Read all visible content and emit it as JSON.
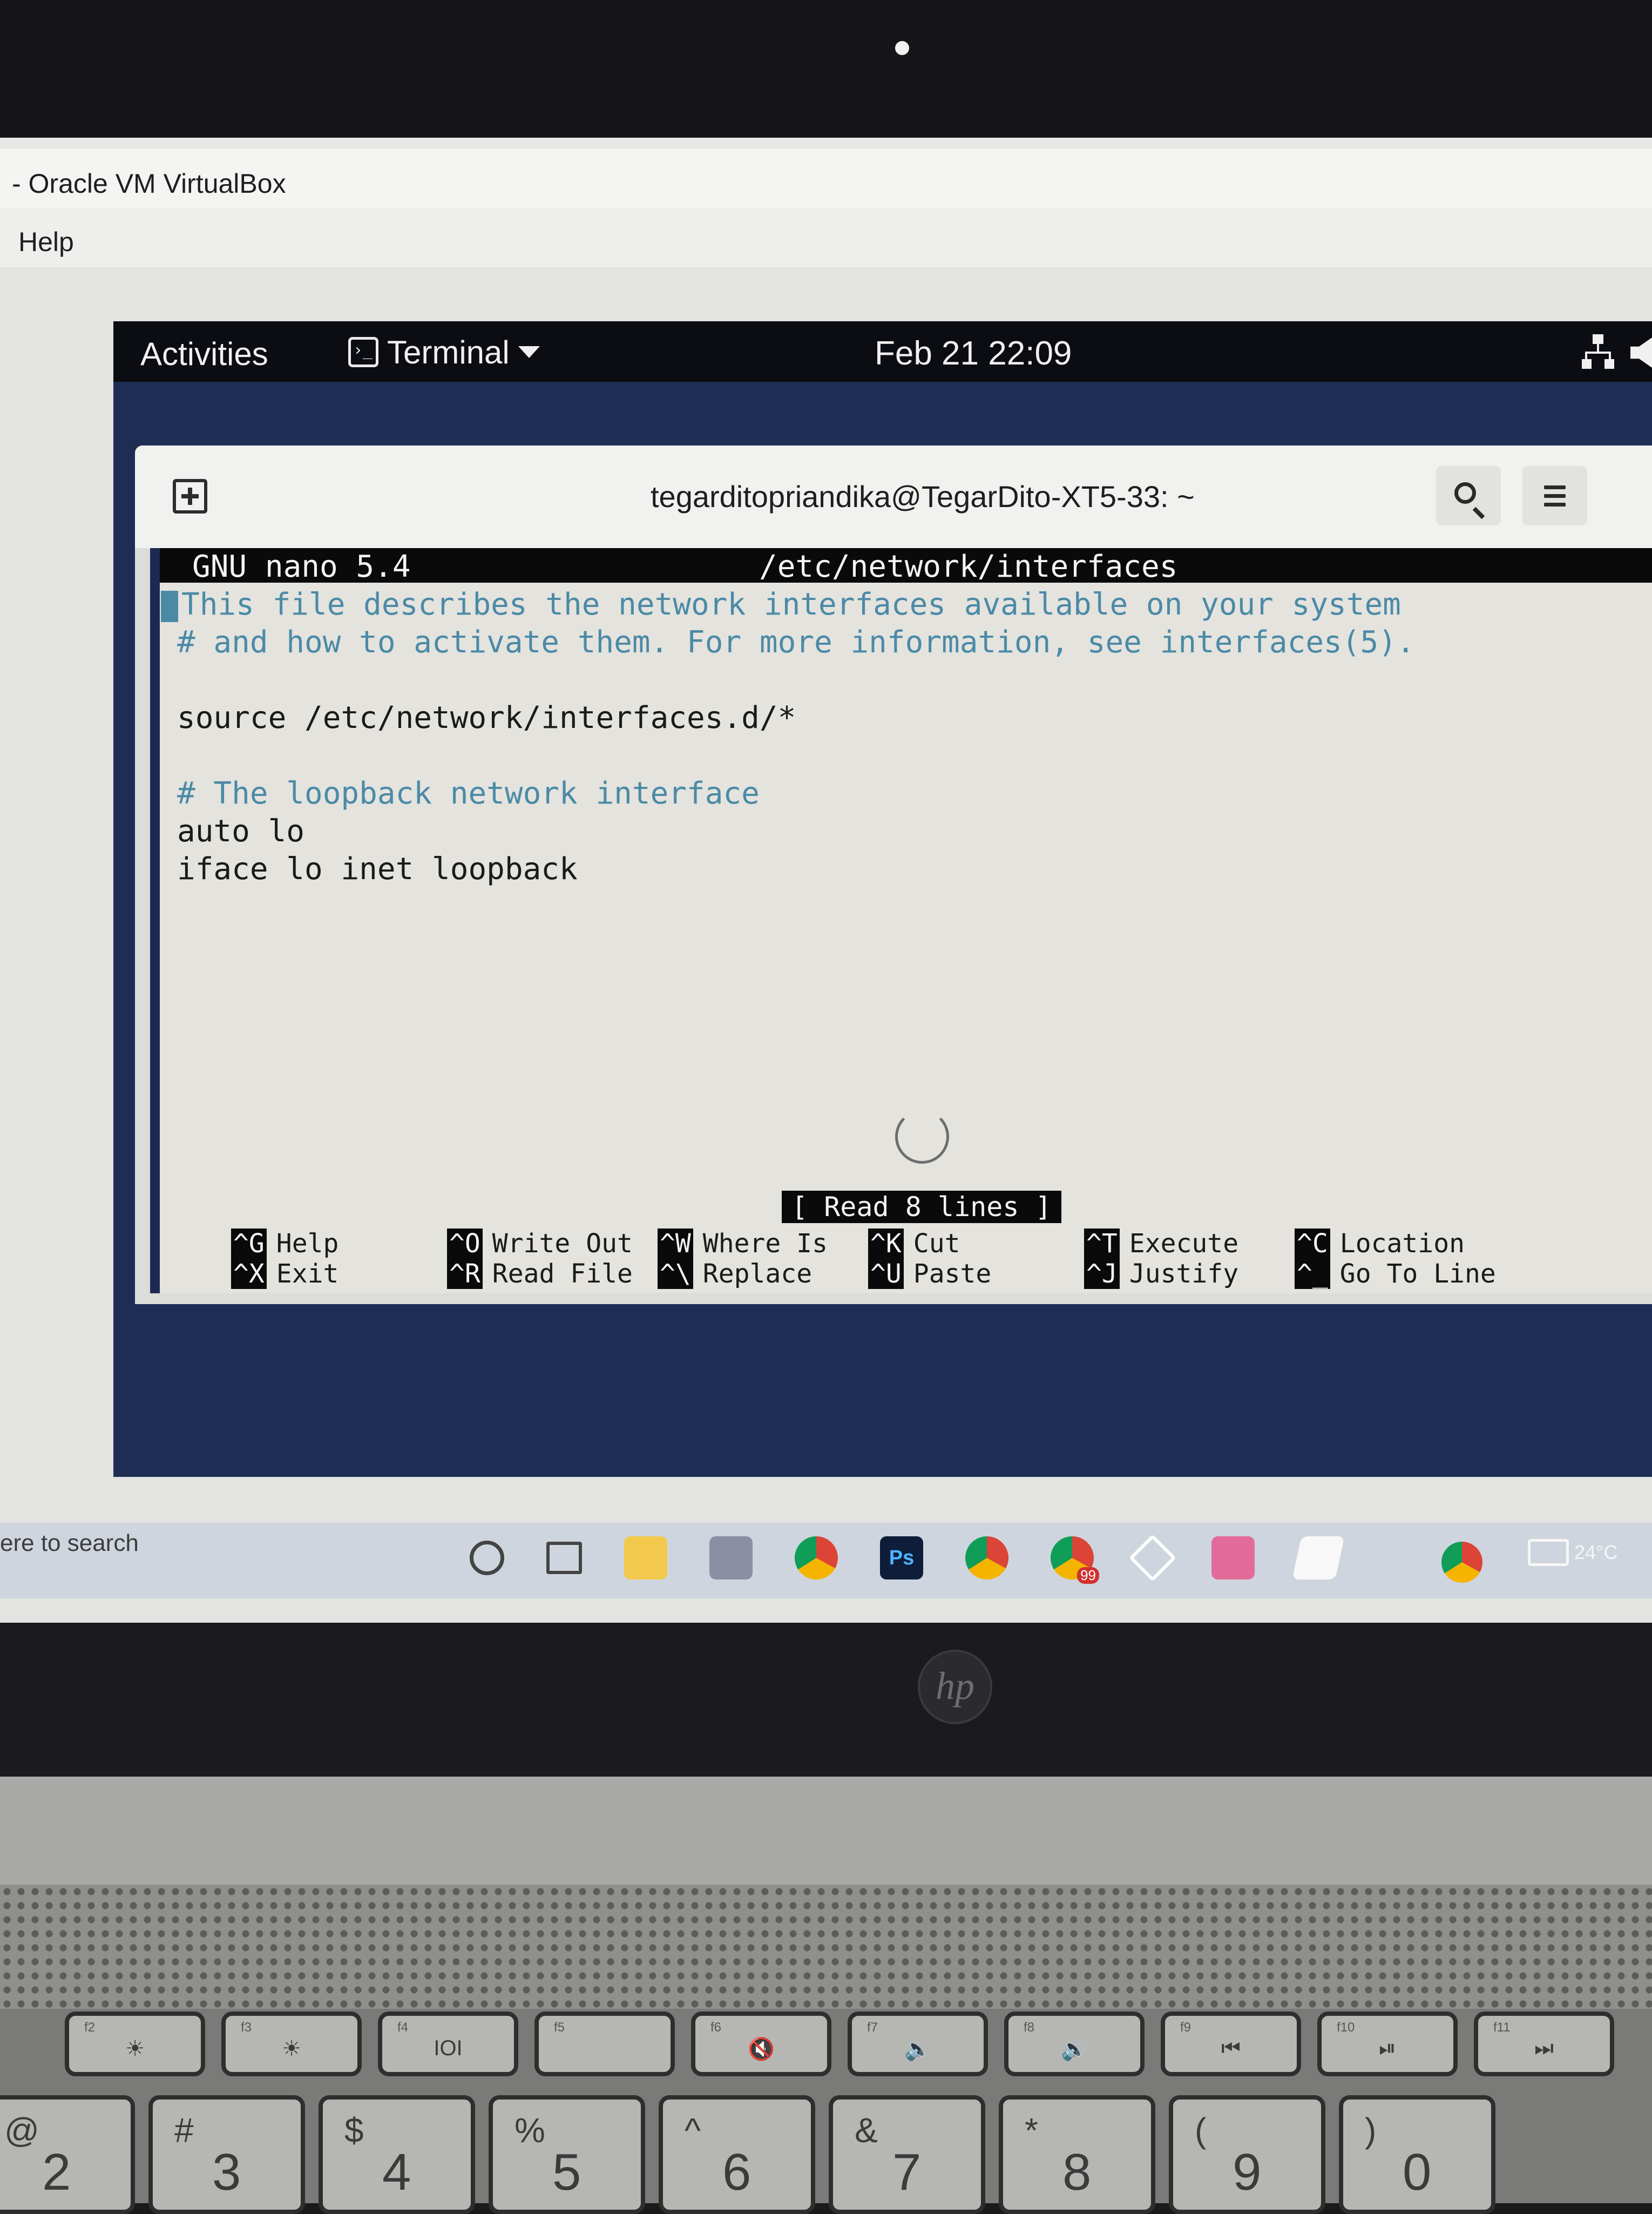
{
  "host_window": {
    "title": "- Oracle VM VirtualBox",
    "menu": [
      "Help"
    ]
  },
  "gnome_top_bar": {
    "activities": "Activities",
    "app_name": "Terminal",
    "clock": "Feb 21  22:09",
    "icons": [
      "network-icon",
      "volume-icon"
    ]
  },
  "terminal": {
    "title": "tegarditopriandika@TegarDito-XT5-33: ~",
    "icons": [
      "new-tab-icon",
      "search-icon",
      "hamburger-menu-icon"
    ]
  },
  "nano": {
    "version": "GNU nano 5.4",
    "filename": "/etc/network/interfaces",
    "lines": [
      {
        "text": "This file describes the network interfaces available on your system",
        "comment": true,
        "prefix": "#"
      },
      {
        "text": "# and how to activate them. For more information, see interfaces(5).",
        "comment": true
      },
      {
        "text": "",
        "comment": false
      },
      {
        "text": "source /etc/network/interfaces.d/*",
        "comment": false
      },
      {
        "text": "",
        "comment": false
      },
      {
        "text": "# The loopback network interface",
        "comment": true
      },
      {
        "text": "auto lo",
        "comment": false
      },
      {
        "text": "iface lo inet loopback",
        "comment": false
      }
    ],
    "status": "[ Read 8 lines ]",
    "shortcuts": [
      {
        "key": "^G",
        "label": "Help"
      },
      {
        "key": "^X",
        "label": "Exit"
      },
      {
        "key": "^O",
        "label": "Write Out"
      },
      {
        "key": "^R",
        "label": "Read File"
      },
      {
        "key": "^W",
        "label": "Where Is"
      },
      {
        "key": "^\\",
        "label": "Replace"
      },
      {
        "key": "^K",
        "label": "Cut"
      },
      {
        "key": "^U",
        "label": "Paste"
      },
      {
        "key": "^T",
        "label": "Execute"
      },
      {
        "key": "^J",
        "label": "Justify"
      },
      {
        "key": "^C",
        "label": "Location"
      },
      {
        "key": "^_",
        "label": "Go To Line"
      }
    ]
  },
  "windows_taskbar": {
    "search_placeholder": "ere to search",
    "notification_badge": "99",
    "ps_label": "Ps",
    "temperature": "24°C"
  },
  "keyboard": {
    "function_keys": [
      {
        "label": "f2",
        "symbol": "☀"
      },
      {
        "label": "f3",
        "symbol": "☀"
      },
      {
        "label": "f4",
        "symbol": "IOI"
      },
      {
        "label": "f5",
        "symbol": ""
      },
      {
        "label": "f6",
        "symbol": "🔇"
      },
      {
        "label": "f7",
        "symbol": "🔉"
      },
      {
        "label": "f8",
        "symbol": "🔊"
      },
      {
        "label": "f9",
        "symbol": "⏮"
      },
      {
        "label": "f10",
        "symbol": "⏯"
      },
      {
        "label": "f11",
        "symbol": "⏭"
      }
    ],
    "number_keys": [
      {
        "top": "@",
        "bottom": "2"
      },
      {
        "top": "#",
        "bottom": "3"
      },
      {
        "top": "$",
        "bottom": "4"
      },
      {
        "top": "%",
        "bottom": "5"
      },
      {
        "top": "^",
        "bottom": "6"
      },
      {
        "top": "&",
        "bottom": "7"
      },
      {
        "top": "*",
        "bottom": "8"
      },
      {
        "top": "(",
        "bottom": "9"
      },
      {
        "top": ")",
        "bottom": "0"
      }
    ],
    "brand": "hp"
  }
}
